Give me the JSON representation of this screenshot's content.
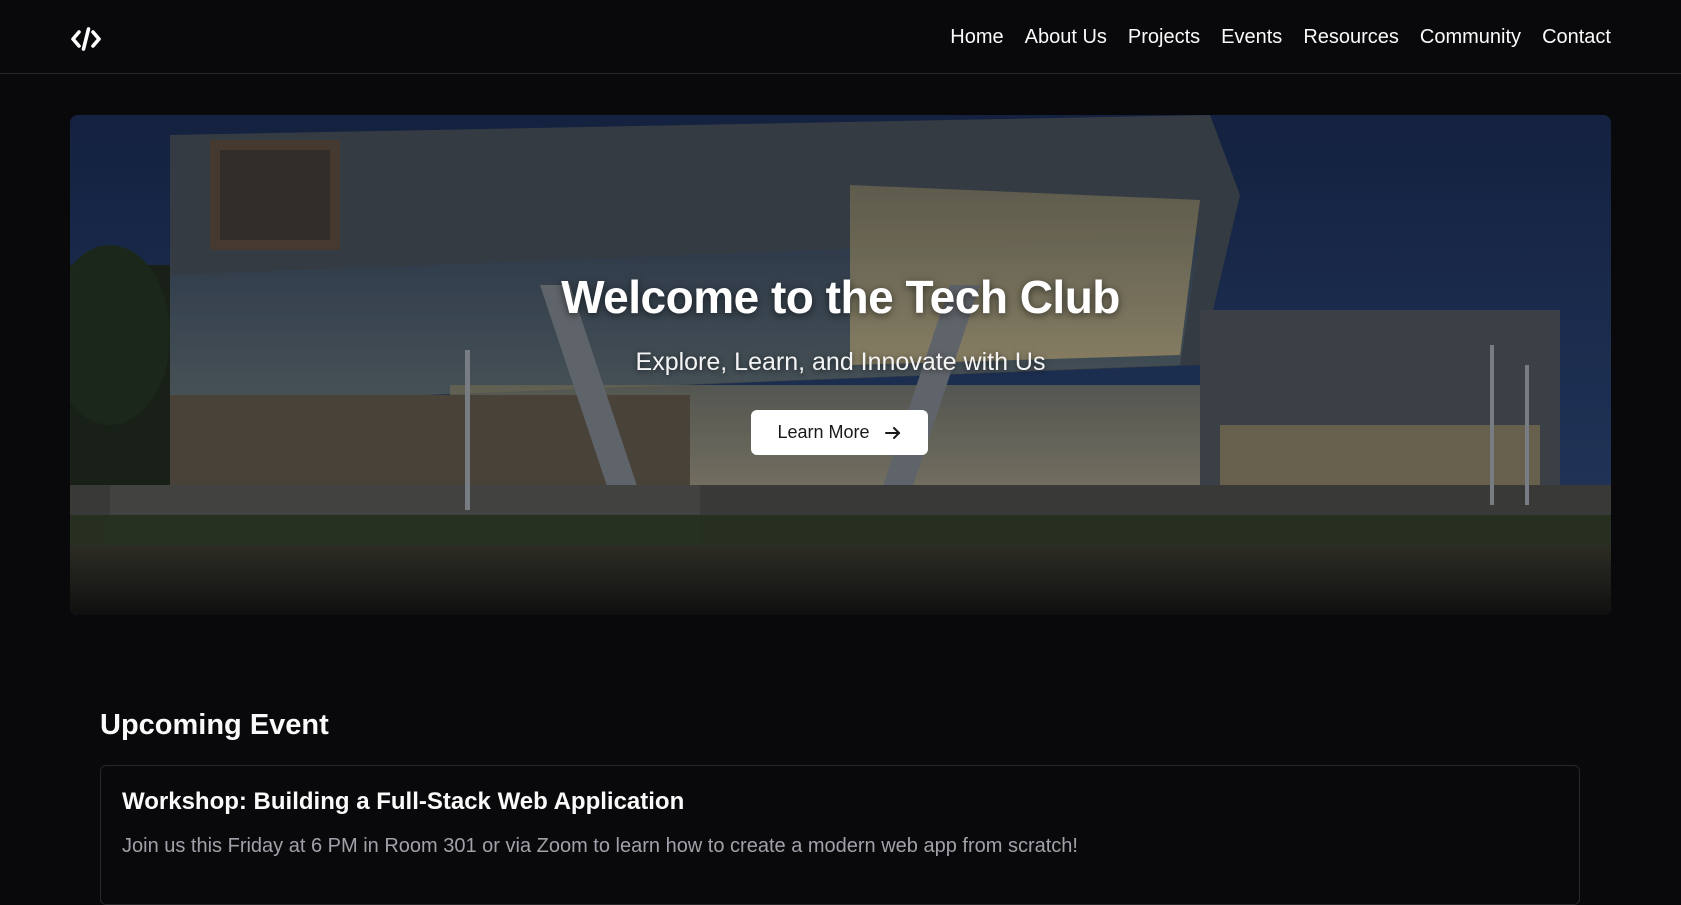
{
  "header": {
    "logo_icon": "code-brackets-icon",
    "nav": [
      {
        "label": "Home"
      },
      {
        "label": "About Us"
      },
      {
        "label": "Projects"
      },
      {
        "label": "Events"
      },
      {
        "label": "Resources"
      },
      {
        "label": "Community"
      },
      {
        "label": "Contact"
      }
    ]
  },
  "hero": {
    "title": "Welcome to the Tech Club",
    "subtitle": "Explore, Learn, and Innovate with Us",
    "button_label": "Learn More",
    "button_icon": "arrow-right-icon"
  },
  "event": {
    "heading": "Upcoming Event",
    "title": "Workshop: Building a Full-Stack Web Application",
    "description": "Join us this Friday at 6 PM in Room 301 or via Zoom to learn how to create a modern web app from scratch!"
  },
  "colors": {
    "background": "#09090b",
    "border": "#27272a",
    "text": "#fafafa",
    "muted_text": "#a1a1aa",
    "button_bg": "#ffffff"
  }
}
